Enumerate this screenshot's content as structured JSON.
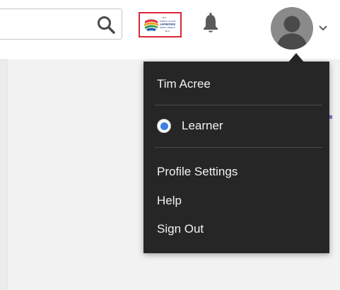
{
  "header": {
    "search": {
      "placeholder": "",
      "icon": "search-icon"
    },
    "logo": {
      "lines": [
        "2017",
        "WORLD SCOUT",
        "JAMBOREE",
        "NORTH AMERICA",
        "2019"
      ]
    },
    "notifications": {
      "icon": "bell-icon"
    },
    "account": {
      "icon": "avatar",
      "menu_icon": "chevron-down-icon"
    }
  },
  "user_menu": {
    "user_name": "Tim Acree",
    "role": {
      "label": "Learner",
      "selected": true
    },
    "items": [
      {
        "label": "Profile Settings"
      },
      {
        "label": "Help"
      },
      {
        "label": "Sign Out"
      }
    ]
  },
  "colors": {
    "menu_background": "#262626",
    "radio_selected": "#3e7fe3",
    "logo_border": "#d9283a"
  }
}
